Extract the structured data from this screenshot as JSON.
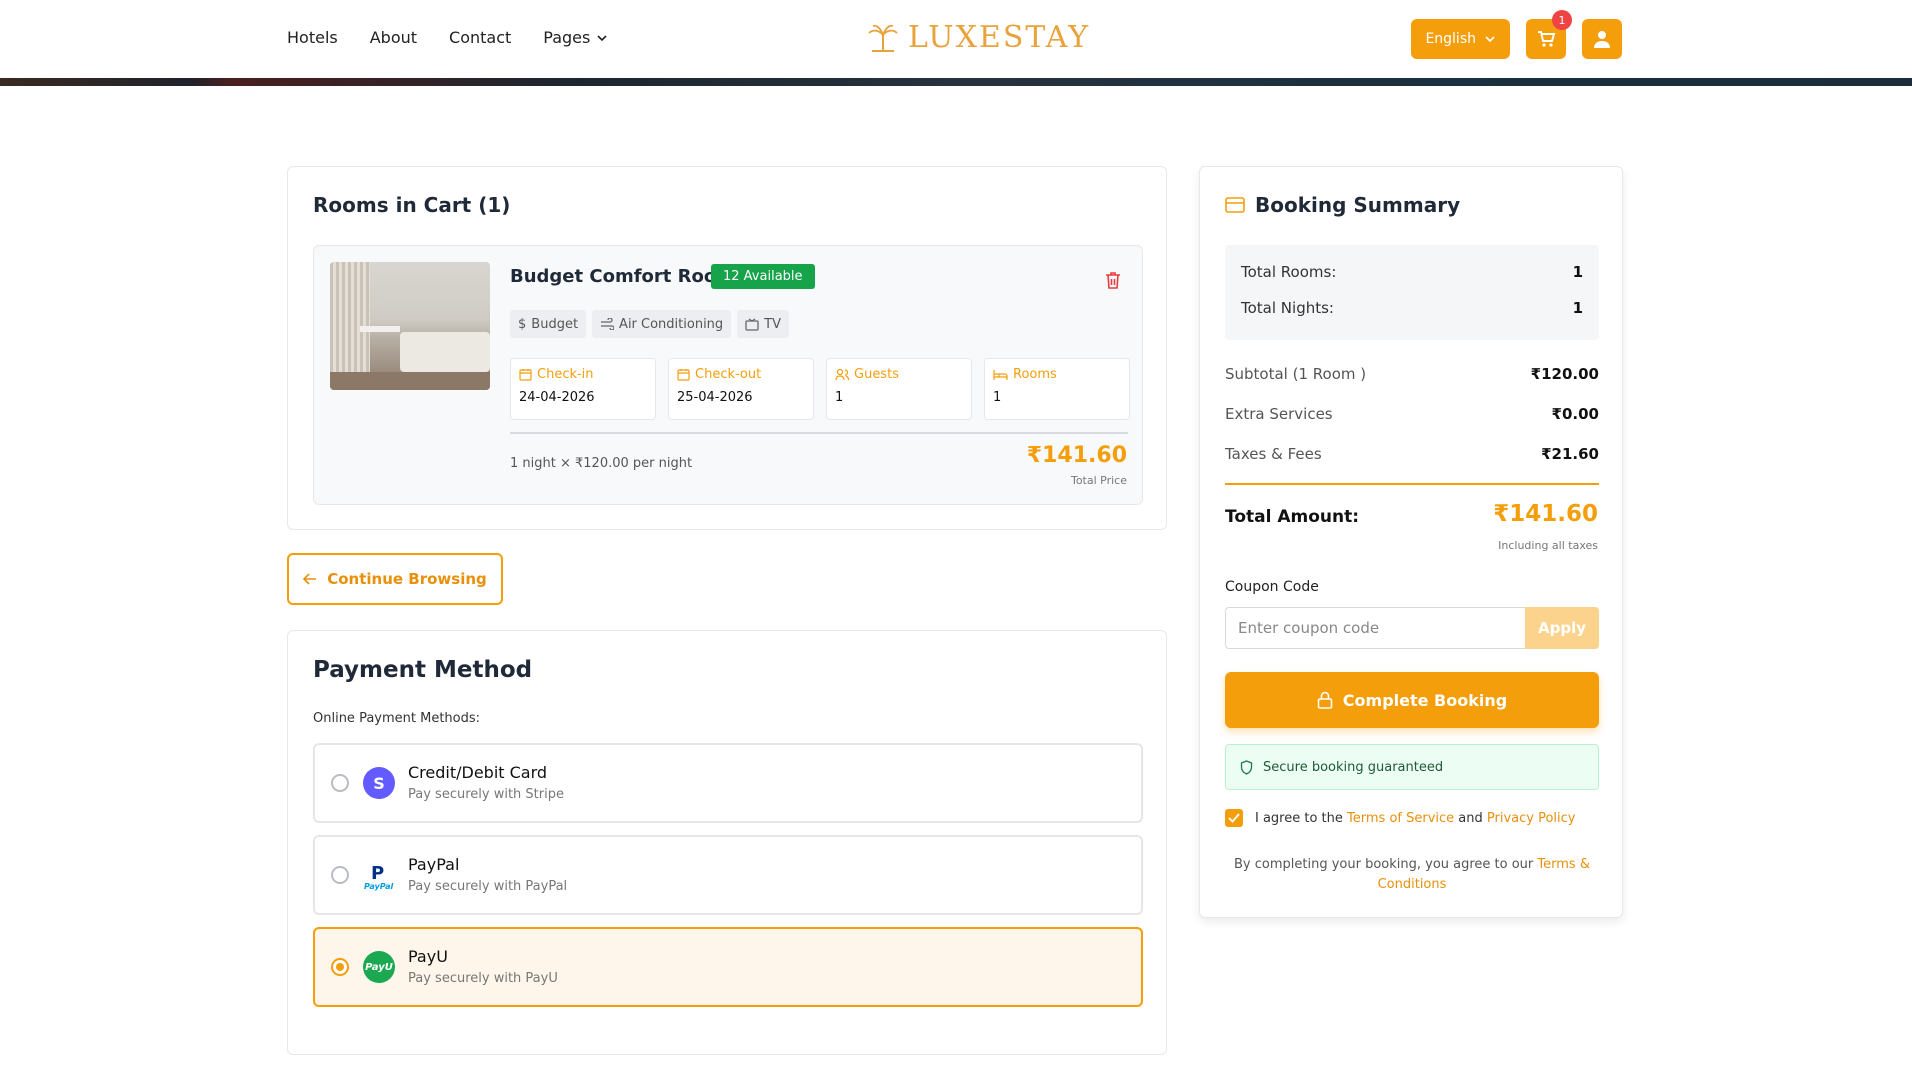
{
  "header": {
    "nav": [
      "Hotels",
      "About",
      "Contact",
      "Pages"
    ],
    "logo": "LUXESTAY",
    "language": "English",
    "cart_count": "1"
  },
  "cart": {
    "title": "Rooms in Cart (1)",
    "room": {
      "name": "Budget Comfort Room",
      "availability": "12 Available",
      "amenities": [
        "Budget",
        "Air Conditioning",
        "TV"
      ],
      "checkin_label": "Check-in",
      "checkin": "24-04-2026",
      "checkout_label": "Check-out",
      "checkout": "25-04-2026",
      "guests_label": "Guests",
      "guests": "1",
      "rooms_label": "Rooms",
      "rooms": "1",
      "per_night": "1 night × ₹120.00 per night",
      "total_price": "₹141.60",
      "total_price_label": "Total Price"
    }
  },
  "continue_browsing": "Continue Browsing",
  "payment": {
    "title": "Payment Method",
    "subtitle": "Online Payment Methods:",
    "options": [
      {
        "name": "Credit/Debit Card",
        "desc": "Pay securely with Stripe",
        "selected": false
      },
      {
        "name": "PayPal",
        "desc": "Pay securely with PayPal",
        "selected": false
      },
      {
        "name": "PayU",
        "desc": "Pay securely with PayU",
        "selected": true
      }
    ]
  },
  "summary": {
    "title": "Booking Summary",
    "total_rooms_label": "Total Rooms:",
    "total_rooms": "1",
    "total_nights_label": "Total Nights:",
    "total_nights": "1",
    "subtotal_label": "Subtotal (1 Room )",
    "subtotal": "₹120.00",
    "extra_label": "Extra Services",
    "extra": "₹0.00",
    "taxes_label": "Taxes & Fees",
    "taxes": "₹21.60",
    "total_label": "Total Amount:",
    "total": "₹141.60",
    "including": "Including all taxes",
    "coupon_label": "Coupon Code",
    "coupon_placeholder": "Enter coupon code",
    "apply": "Apply",
    "complete": "Complete Booking",
    "secure": "Secure booking guaranteed",
    "agree_prefix": "I agree to the",
    "terms_of_service": "Terms of Service",
    "and": "and",
    "privacy_policy": "Privacy Policy",
    "note_prefix": "By completing your booking, you agree to our",
    "terms_conditions": "Terms & Conditions"
  },
  "colors": {
    "accent": "#f59e0b",
    "success": "#16a34a",
    "danger": "#ef4444"
  }
}
